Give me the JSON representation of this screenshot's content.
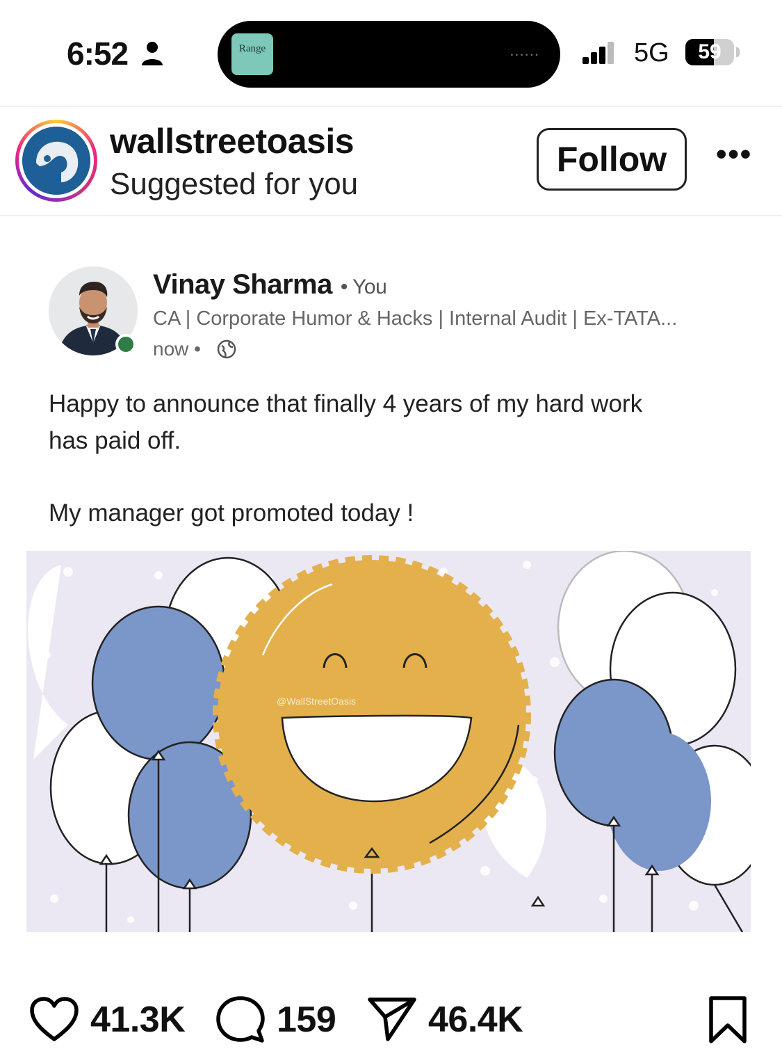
{
  "status_bar": {
    "time": "6:52",
    "live_activity_art_label": "Range",
    "live_activity_dots": "......",
    "network": "5G",
    "battery_level": "59",
    "battery_fraction": 0.59
  },
  "post_header": {
    "username": "wallstreetoasis",
    "subtitle": "Suggested for you",
    "follow_label": "Follow",
    "more_label": "•••"
  },
  "linkedin_card": {
    "name": "Vinay Sharma",
    "relation": "• You",
    "headline": "CA | Corporate Humor & Hacks | Internal Audit | Ex-TATA...",
    "time": "now •",
    "text_line1": "Happy to announce that finally 4 years of my hard work",
    "text_line2": "has paid off.",
    "text_line3": "My manager got promoted today !",
    "watermark": "@WallStreetOasis"
  },
  "actions": {
    "likes": "41.3K",
    "comments": "159",
    "shares": "46.4K"
  },
  "colors": {
    "balloon_blue": "#7b96c8",
    "smiley_gold": "#e3b04b",
    "image_bg": "#ebe8f4",
    "online_green": "#2e7d45"
  }
}
